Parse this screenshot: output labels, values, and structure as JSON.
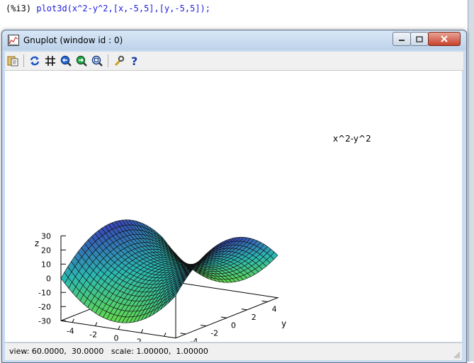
{
  "console": {
    "prompt": "(%i3)",
    "command": "plot3d(x^2-y^2,[x,-5,5],[y,-5,5]);"
  },
  "window": {
    "title": "Gnuplot (window id : 0)",
    "buttons": [
      "minimize",
      "maximize",
      "close"
    ]
  },
  "toolbar": {
    "icons": [
      "copy-to-clipboard-icon",
      "replot-icon",
      "grid-icon",
      "zoom-previous-icon",
      "zoom-next-icon",
      "unzoom-icon",
      "options-icon",
      "help-icon"
    ]
  },
  "status": {
    "text": "view: 60.0000,  30.0000   scale: 1.00000,  1.00000"
  },
  "chart_data": {
    "type": "surface",
    "function": "x^2-y^2",
    "legend": "x^2-y^2",
    "xlabel": "x",
    "ylabel": "y",
    "zlabel": "z",
    "xlim": [
      -5,
      5
    ],
    "ylim": [
      -5,
      5
    ],
    "zlim": [
      -30,
      30
    ],
    "x_ticks": [
      "-4",
      "-2",
      "0",
      "2",
      "4"
    ],
    "y_ticks": [
      "-4",
      "-2",
      "0",
      "2",
      "4"
    ],
    "z_ticks": [
      "30",
      "20",
      "10",
      "0",
      "-10",
      "-20",
      "-30"
    ],
    "view": [
      60,
      30
    ],
    "grid_samples": 30,
    "colors": {
      "high": "#3b2db8",
      "mid": "#2bb8b2",
      "low": "#6fe03a"
    }
  }
}
